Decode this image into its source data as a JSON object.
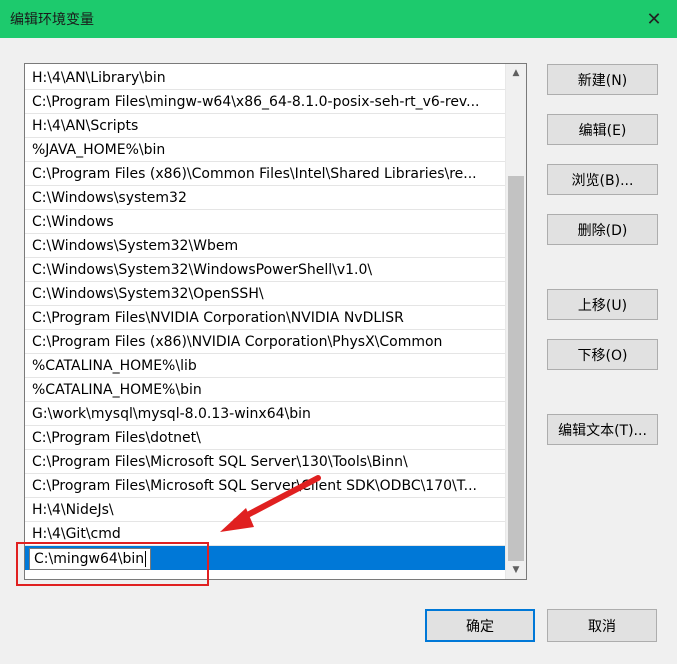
{
  "window": {
    "title": "编辑环境变量",
    "close_glyph": "✕"
  },
  "list": {
    "rows": [
      "H:\\4\\AN\\Library\\bin",
      "C:\\Program Files\\mingw-w64\\x86_64-8.1.0-posix-seh-rt_v6-rev...",
      "H:\\4\\AN\\Scripts",
      "%JAVA_HOME%\\bin",
      "C:\\Program Files (x86)\\Common Files\\Intel\\Shared Libraries\\re...",
      "C:\\Windows\\system32",
      "C:\\Windows",
      "C:\\Windows\\System32\\Wbem",
      "C:\\Windows\\System32\\WindowsPowerShell\\v1.0\\",
      "C:\\Windows\\System32\\OpenSSH\\",
      "C:\\Program Files\\NVIDIA Corporation\\NVIDIA NvDLISR",
      "C:\\Program Files (x86)\\NVIDIA Corporation\\PhysX\\Common",
      "%CATALINA_HOME%\\lib",
      "%CATALINA_HOME%\\bin",
      "G:\\work\\mysql\\mysql-8.0.13-winx64\\bin",
      "C:\\Program Files\\dotnet\\",
      "C:\\Program Files\\Microsoft SQL Server\\130\\Tools\\Binn\\",
      "C:\\Program Files\\Microsoft SQL Server\\Client SDK\\ODBC\\170\\T...",
      "H:\\4\\NideJs\\",
      "H:\\4\\Git\\cmd"
    ],
    "editing_value": "C:\\mingw64\\bin"
  },
  "buttons": {
    "new": "新建(N)",
    "edit": "编辑(E)",
    "browse": "浏览(B)...",
    "delete": "删除(D)",
    "move_up": "上移(U)",
    "move_down": "下移(O)",
    "edit_text": "编辑文本(T)...",
    "ok": "确定",
    "cancel": "取消"
  },
  "colors": {
    "titlebar": "#1dca6d",
    "selection": "#0078d7",
    "annotation": "#e02020"
  },
  "icons": {
    "scroll_up": "chevron-up-icon",
    "scroll_down": "chevron-down-icon",
    "close": "close-icon"
  }
}
